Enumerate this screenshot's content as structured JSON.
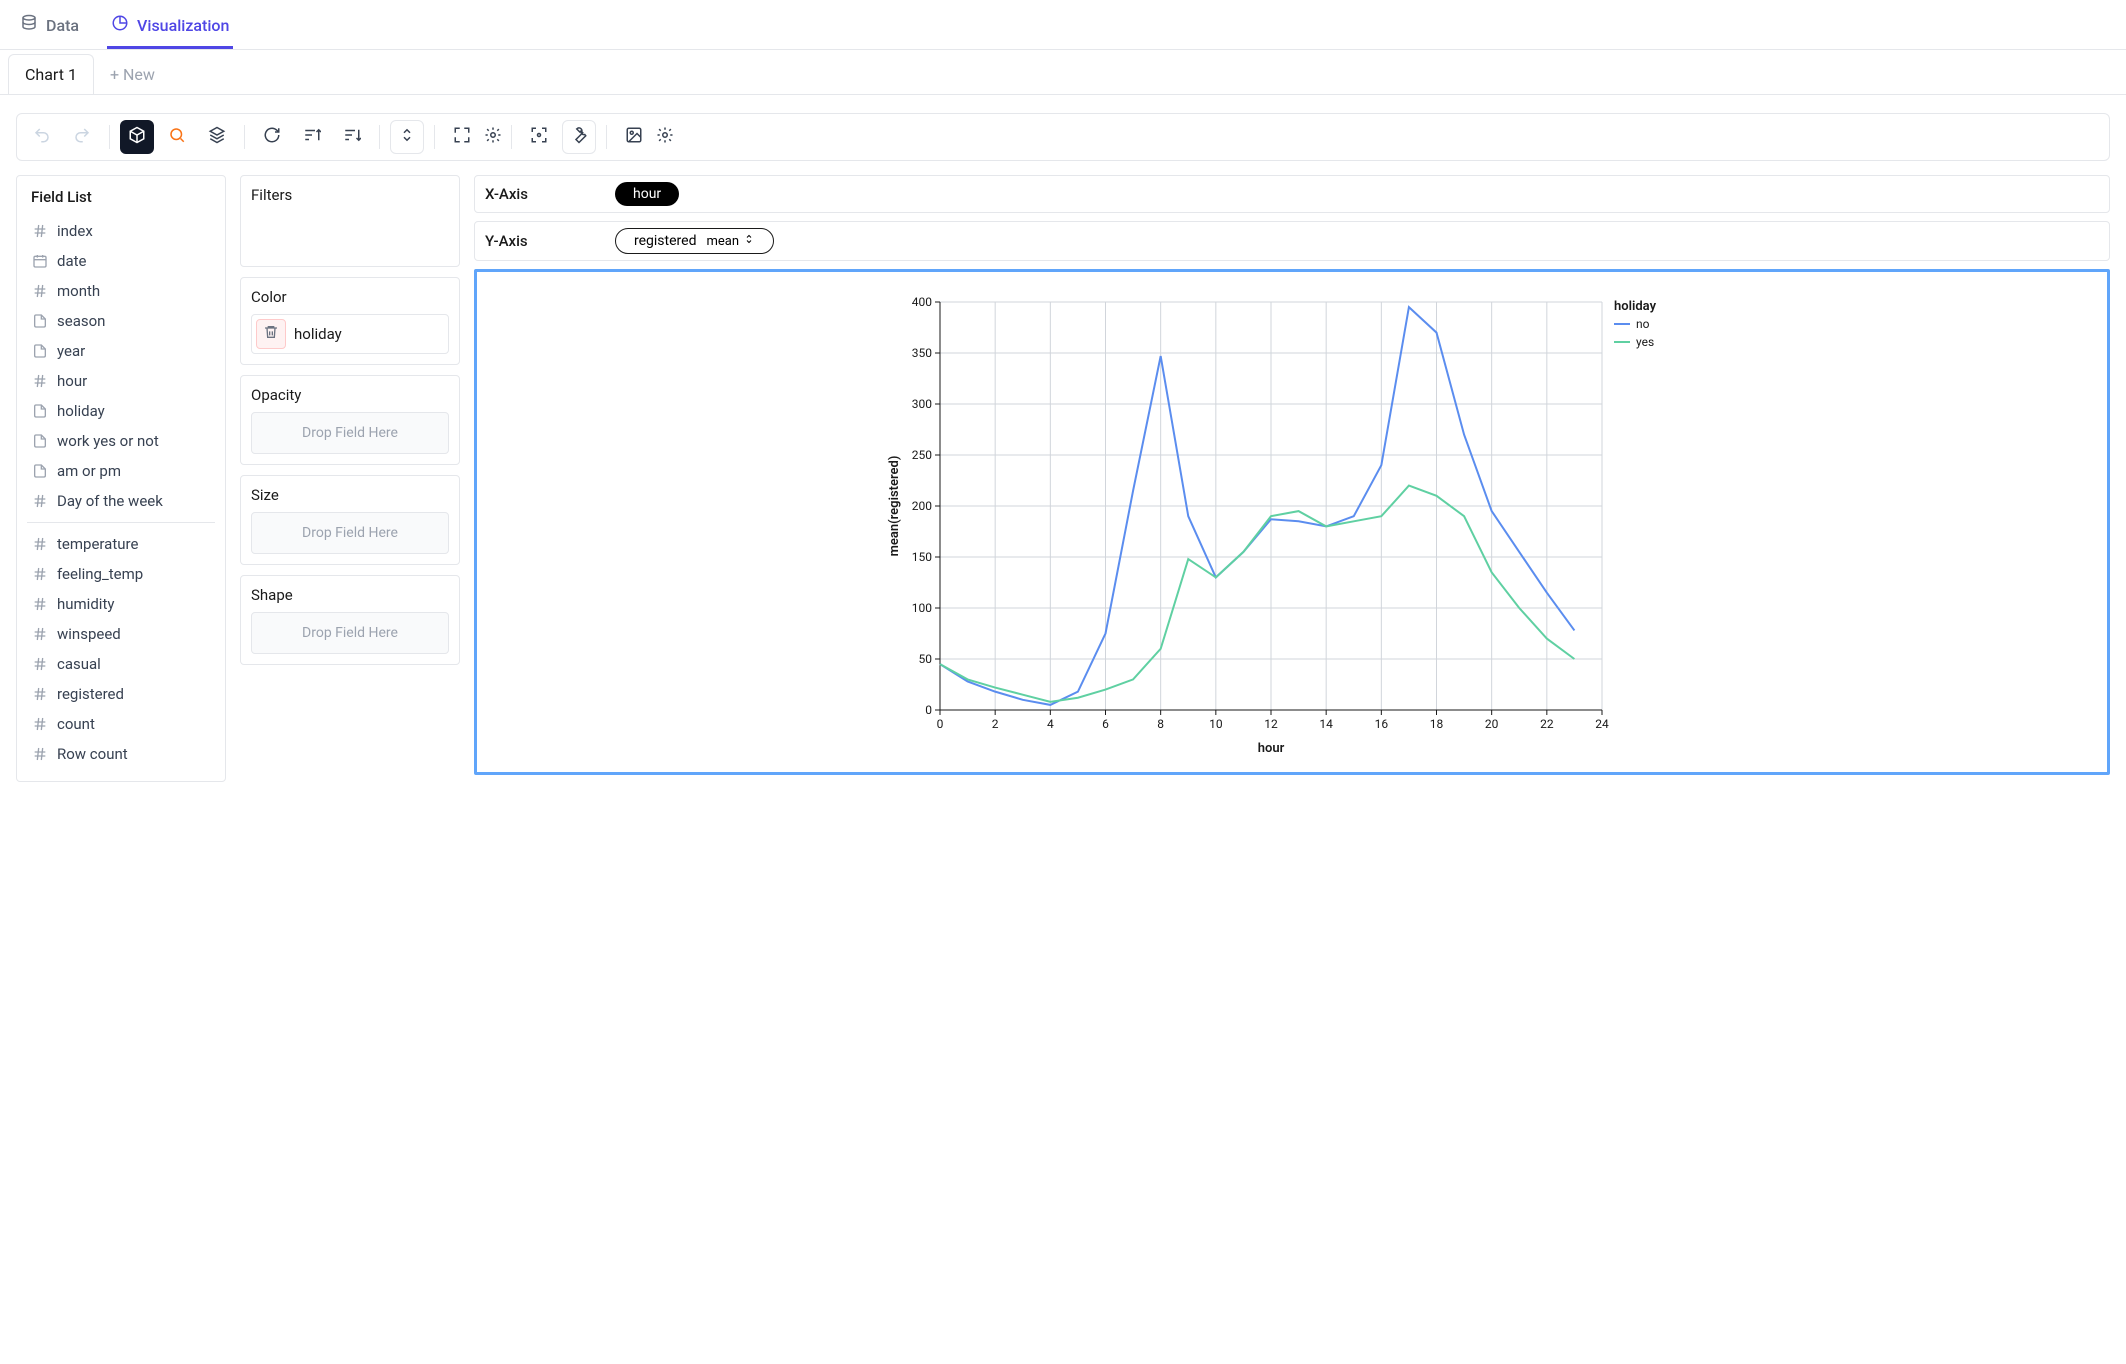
{
  "nav": {
    "data_label": "Data",
    "viz_label": "Visualization"
  },
  "chart_tabs": {
    "chart1": "Chart 1",
    "new": "+ New"
  },
  "field_list": {
    "title": "Field List",
    "groups": [
      [
        {
          "icon": "hash",
          "label": "index"
        },
        {
          "icon": "calendar",
          "label": "date"
        },
        {
          "icon": "hash",
          "label": "month"
        },
        {
          "icon": "file",
          "label": "season"
        },
        {
          "icon": "file",
          "label": "year"
        },
        {
          "icon": "hash",
          "label": "hour"
        },
        {
          "icon": "file",
          "label": "holiday"
        },
        {
          "icon": "file",
          "label": "work yes or not"
        },
        {
          "icon": "file",
          "label": "am or pm"
        },
        {
          "icon": "hash",
          "label": "Day of the week"
        }
      ],
      [
        {
          "icon": "hash",
          "label": "temperature"
        },
        {
          "icon": "hash",
          "label": "feeling_temp"
        },
        {
          "icon": "hash",
          "label": "humidity"
        },
        {
          "icon": "hash",
          "label": "winspeed"
        },
        {
          "icon": "hash",
          "label": "casual"
        },
        {
          "icon": "hash",
          "label": "registered"
        },
        {
          "icon": "hash",
          "label": "count"
        },
        {
          "icon": "hash",
          "label": "Row count"
        }
      ]
    ]
  },
  "encodings": {
    "filters": "Filters",
    "color": "Color",
    "color_value": "holiday",
    "opacity": "Opacity",
    "size": "Size",
    "shape": "Shape",
    "drop_placeholder": "Drop Field Here"
  },
  "axes": {
    "x_label": "X-Axis",
    "x_value": "hour",
    "y_label": "Y-Axis",
    "y_value": "registered",
    "y_agg": "mean"
  },
  "chart_data": {
    "type": "line",
    "title": "",
    "xlabel": "hour",
    "ylabel": "mean(registered)",
    "xlim": [
      0,
      24
    ],
    "ylim": [
      0,
      400
    ],
    "x_ticks": [
      0,
      2,
      4,
      6,
      8,
      10,
      12,
      14,
      16,
      18,
      20,
      22,
      24
    ],
    "y_ticks": [
      0,
      50,
      100,
      150,
      200,
      250,
      300,
      350,
      400
    ],
    "x": [
      0,
      1,
      2,
      3,
      4,
      5,
      6,
      7,
      8,
      9,
      10,
      11,
      12,
      13,
      14,
      15,
      16,
      17,
      18,
      19,
      20,
      21,
      22,
      23
    ],
    "legend_title": "holiday",
    "series": [
      {
        "name": "no",
        "color": "#5b8def",
        "values": [
          45,
          28,
          18,
          10,
          5,
          18,
          75,
          215,
          347,
          190,
          130,
          155,
          187,
          185,
          180,
          190,
          240,
          395,
          370,
          270,
          195,
          155,
          115,
          78
        ]
      },
      {
        "name": "yes",
        "color": "#5fd0a2",
        "values": [
          45,
          30,
          22,
          15,
          8,
          12,
          20,
          30,
          60,
          148,
          130,
          155,
          190,
          195,
          180,
          185,
          190,
          220,
          210,
          190,
          135,
          100,
          70,
          50
        ]
      }
    ]
  }
}
